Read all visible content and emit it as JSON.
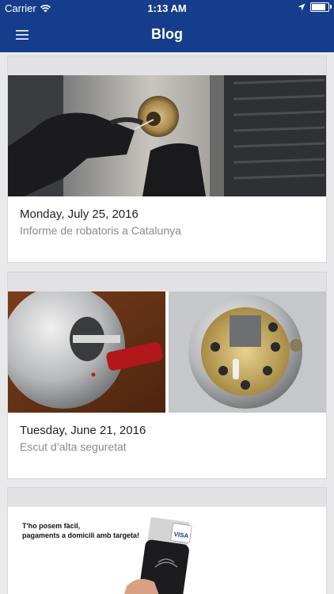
{
  "status_bar": {
    "carrier": "Carrier",
    "time": "1:13 AM",
    "battery_level": 0.95
  },
  "nav": {
    "title": "Blog"
  },
  "icons": {
    "menu": "hamburger-menu-icon",
    "wifi": "wifi-icon",
    "location": "location-arrow-icon",
    "battery": "battery-icon"
  },
  "colors": {
    "nav_bg": "#163d8c",
    "page_bg": "#e9e9ec",
    "card_bg": "#ffffff"
  },
  "posts": [
    {
      "date": "Monday, July 25, 2016",
      "title": "Informe de robatoris a Catalunya"
    },
    {
      "date": "Tuesday, June 21, 2016",
      "title": "Escut d’alta seguretat"
    },
    {
      "ad_line1": "T'ho posem fàcil,",
      "ad_line2": "pagaments a domicili amb targeta!",
      "card_brand": "VISA"
    }
  ]
}
